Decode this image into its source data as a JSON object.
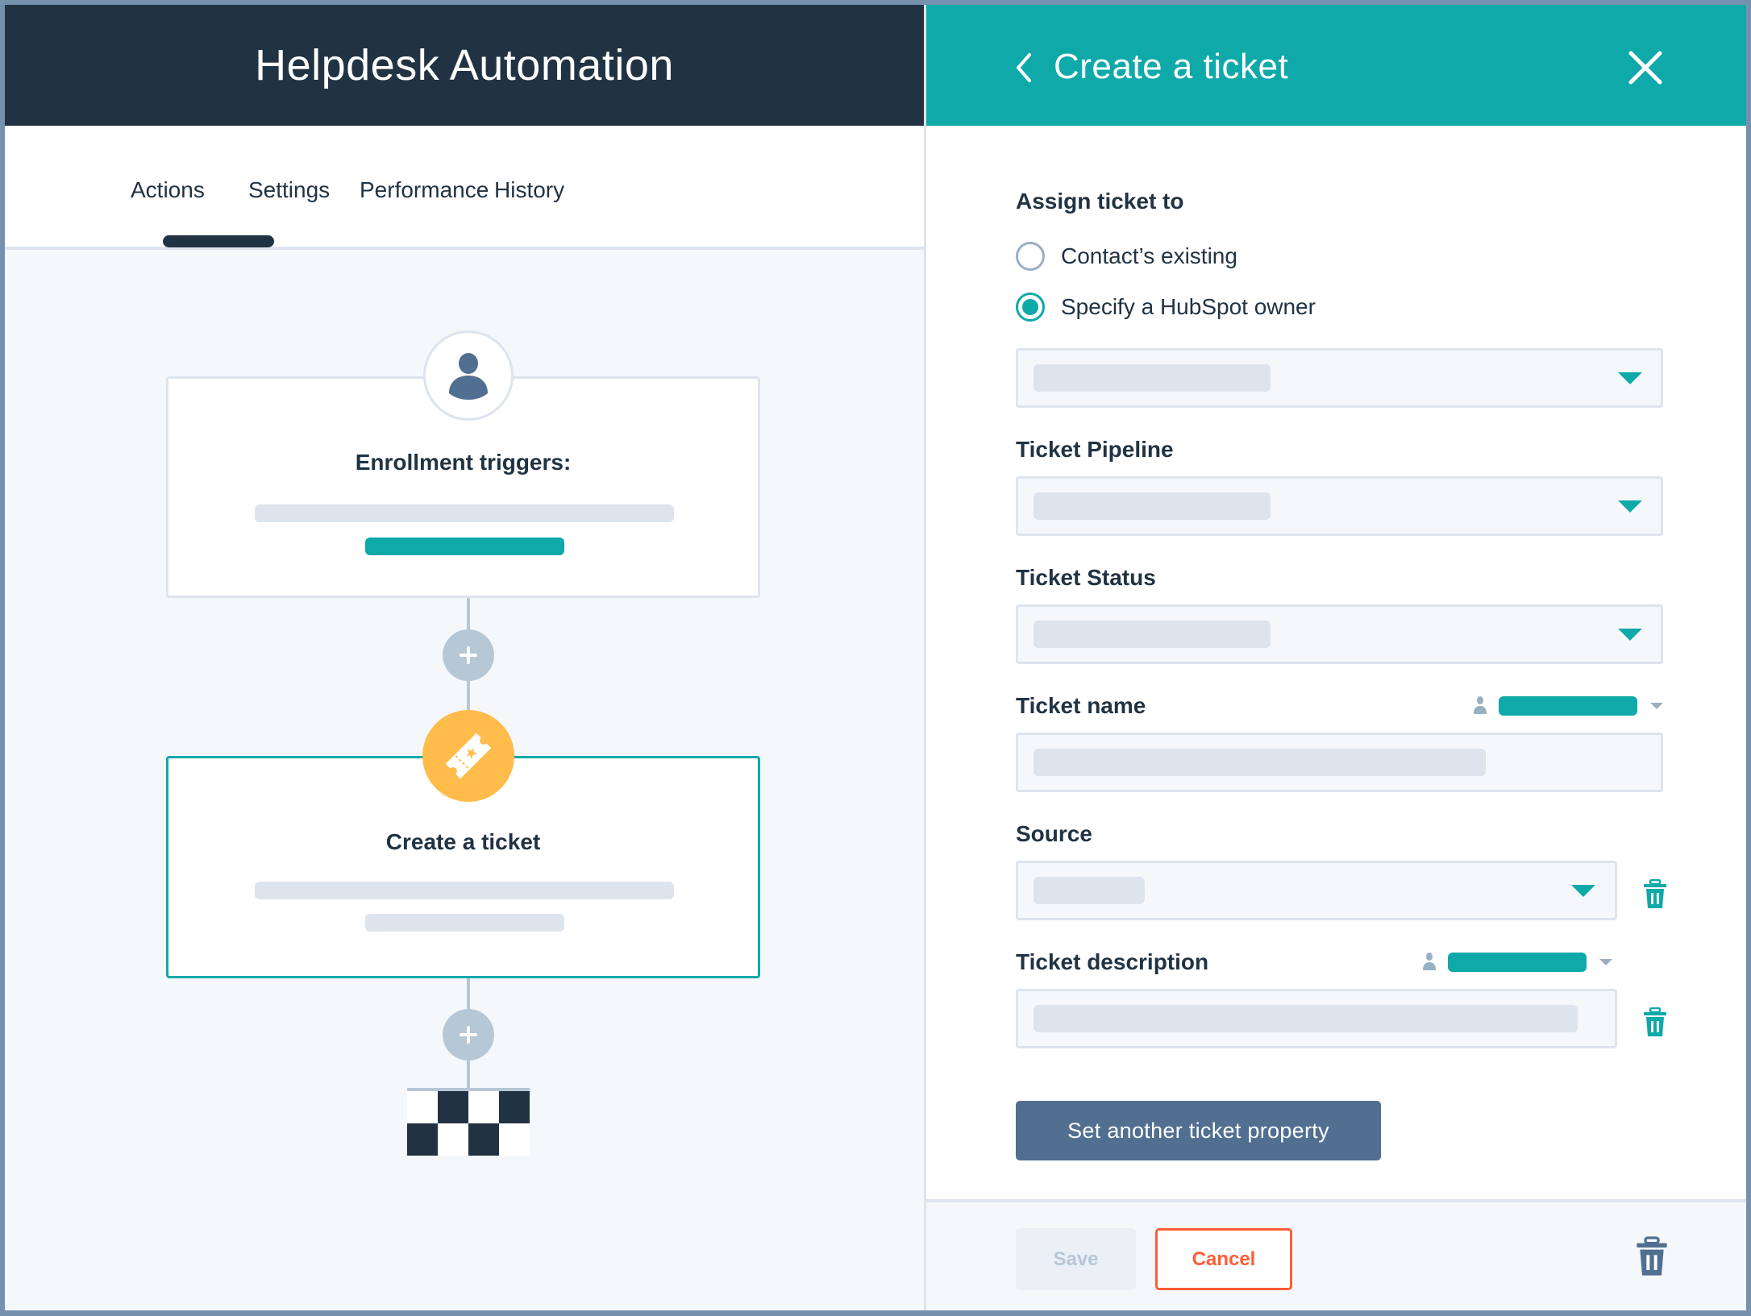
{
  "workflow": {
    "title": "Helpdesk Automation",
    "tabs": [
      {
        "label": "Actions",
        "active": true
      },
      {
        "label": "Settings",
        "active": false
      },
      {
        "label": "Performance",
        "active": false
      },
      {
        "label": "History",
        "active": false
      }
    ],
    "enrollment_card": {
      "title": "Enrollment triggers:",
      "icon": "person-icon"
    },
    "action_card": {
      "title": "Create a ticket",
      "icon": "ticket-icon"
    },
    "end_icon": "checkered-flag-icon"
  },
  "panel": {
    "title": "Create a ticket",
    "back_icon": "chevron-left-icon",
    "close_icon": "close-icon",
    "assign_label": "Assign ticket to",
    "assign_options": [
      {
        "label": "Contact’s existing",
        "checked": false
      },
      {
        "label": "Specify a HubSpot owner",
        "checked": true
      }
    ],
    "fields": {
      "pipeline": "Ticket Pipeline",
      "status": "Ticket Status",
      "name": "Ticket name",
      "source": "Source",
      "description": "Ticket description"
    },
    "set_property_button": "Set another ticket property",
    "footer": {
      "save": "Save",
      "cancel": "Cancel",
      "save_disabled": true
    }
  },
  "colors": {
    "navy": "#213343",
    "teal": "#0fa9a9",
    "orange": "#ffbc4b",
    "cancel": "#ff5c35",
    "slate": "#516f90"
  }
}
